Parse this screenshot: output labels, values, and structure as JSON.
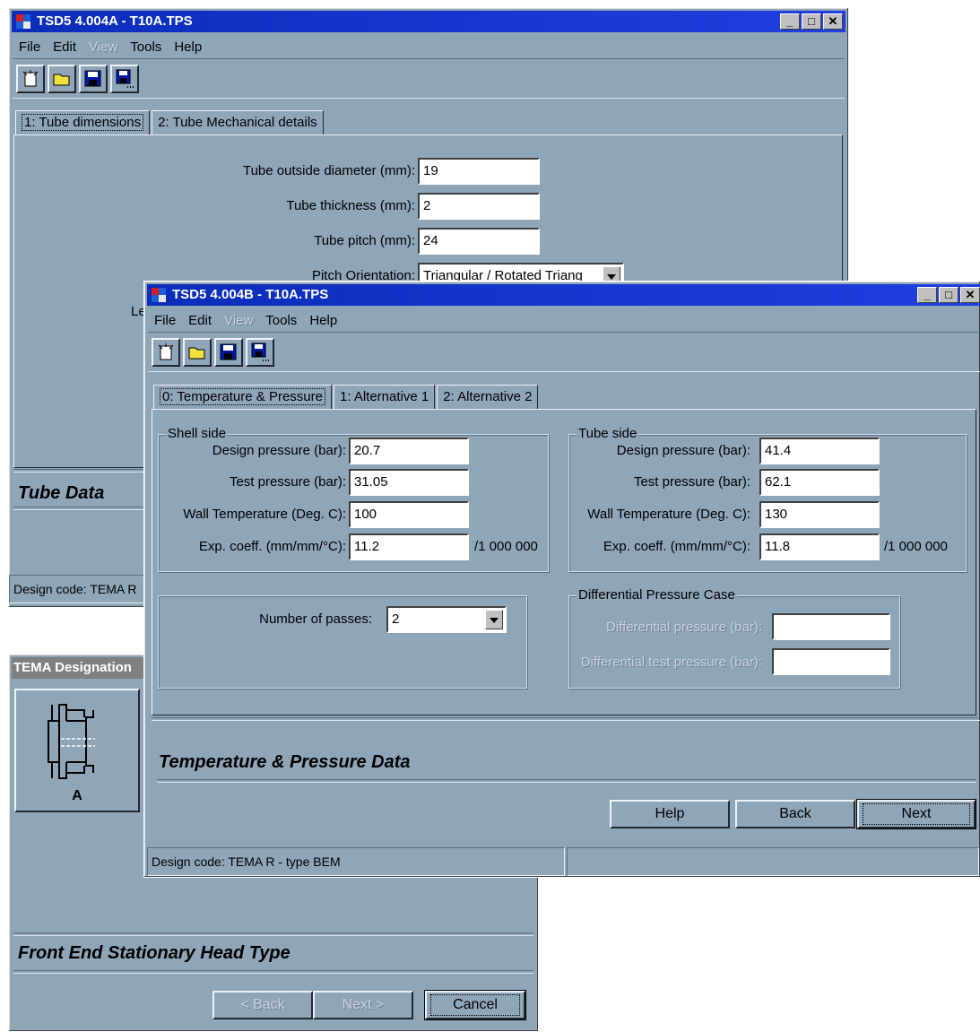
{
  "win_a": {
    "title": "TSD5 4.004A - T10A.TPS",
    "menu": [
      "File",
      "Edit",
      "View",
      "Tools",
      "Help"
    ],
    "tabs": [
      "1: Tube dimensions",
      "2: Tube Mechanical details"
    ],
    "fields": [
      {
        "label": "Tube outside diameter (mm):",
        "value": "19"
      },
      {
        "label": "Tube thickness (mm):",
        "value": "2"
      },
      {
        "label": "Tube pitch (mm):",
        "value": "24"
      }
    ],
    "pitch_label": "Pitch Orientation:",
    "pitch_value": "Triangular / Rotated Triang",
    "partial_label": "Le",
    "section": "Tube Data",
    "status": "Design code: TEMA R"
  },
  "win_tema": {
    "title": "TEMA Designation",
    "head_letter": "A",
    "section": "Front End Stationary Head Type",
    "back": "< Back",
    "next": "Next >",
    "cancel": "Cancel"
  },
  "win_b": {
    "title": "TSD5 4.004B - T10A.TPS",
    "menu": [
      "File",
      "Edit",
      "View",
      "Tools",
      "Help"
    ],
    "tabs": [
      "0: Temperature  & Pressure",
      "1: Alternative 1",
      "2: Alternative 2"
    ],
    "shell": {
      "title": "Shell side",
      "fields": [
        {
          "label": "Design pressure (bar):",
          "value": "20.7"
        },
        {
          "label": "Test pressure (bar):",
          "value": "31.05"
        },
        {
          "label": "Wall Temperature (Deg. C):",
          "value": "100"
        },
        {
          "label": "Exp. coeff. (mm/mm/°C):",
          "value": "11.2"
        }
      ],
      "unit": "/1 000 000"
    },
    "tube": {
      "title": "Tube side",
      "fields": [
        {
          "label": "Design pressure (bar):",
          "value": "41.4"
        },
        {
          "label": "Test pressure (bar):",
          "value": "62.1"
        },
        {
          "label": "Wall Temperature (Deg. C):",
          "value": "130"
        },
        {
          "label": "Exp. coeff. (mm/mm/°C):",
          "value": "11.8"
        }
      ],
      "unit": "/1 000 000"
    },
    "passes_label": "Number of passes:",
    "passes_value": "2",
    "diff": {
      "title": "Differential Pressure  Case",
      "pressure_label": "Differential  pressure (bar):",
      "test_label": "Differential test pressure (bar):"
    },
    "section": "Temperature & Pressure Data",
    "help": "Help",
    "back": "Back",
    "next": "Next",
    "status": "Design code: TEMA R - type BEM"
  }
}
